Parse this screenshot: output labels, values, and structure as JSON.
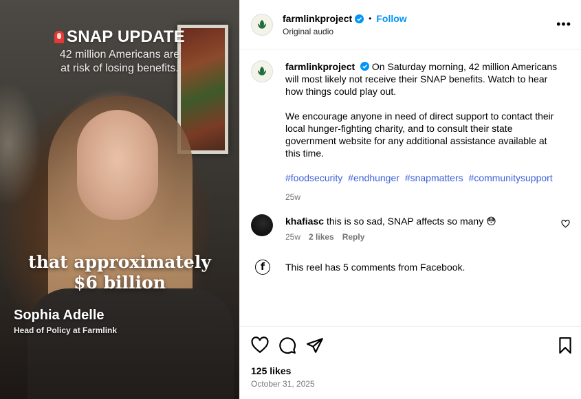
{
  "video": {
    "title": "SNAP UPDATE",
    "subtitle_lines": [
      "42 million Americans are",
      "at risk of losing benefits."
    ],
    "caption_lines": [
      "that approximately",
      "$6 billion"
    ],
    "speaker_name": "Sophia Adelle",
    "speaker_role": "Head of Policy at Farmlink"
  },
  "header": {
    "username": "farmlinkproject",
    "separator": "•",
    "follow_label": "Follow",
    "audio": "Original audio",
    "more_label": "•••"
  },
  "caption": {
    "username": "farmlinkproject",
    "paragraph1": "On Saturday morning, 42 million Americans will most likely not receive their SNAP benefits. Watch to hear how things could play out.",
    "paragraph2": "We encourage anyone in need of direct support to contact their local hunger-fighting charity, and to consult their state government website for any additional assistance available at this time.",
    "hashtags": [
      "#foodsecurity",
      "#endhunger",
      "#snapmatters",
      "#communitysupport"
    ],
    "time": "25w"
  },
  "comment": {
    "username": "khafiasc",
    "text": "this is so sad, SNAP affects so many 😳",
    "time": "25w",
    "likes": "2 likes",
    "reply_label": "Reply"
  },
  "facebook_note": {
    "icon_glyph": "f",
    "text": "This reel has 5 comments from Facebook."
  },
  "footer": {
    "likes": "125 likes",
    "date": "October 31, 2025"
  },
  "colors": {
    "accent_link": "#0095f6",
    "verified": "#0095f6",
    "hashtag": "#3b5fd8",
    "muted_text": "#737373",
    "brand_green": "#1f6b3a"
  }
}
